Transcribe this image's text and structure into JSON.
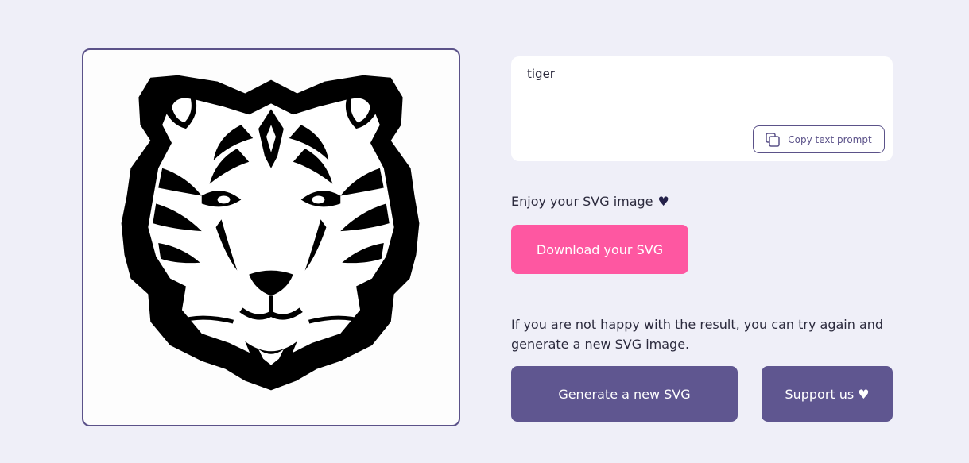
{
  "image_card": {
    "alt_subject": "tiger-illustration"
  },
  "prompt": {
    "text": "tiger",
    "copy_label": "Copy text prompt",
    "copy_icon": "copy-icon"
  },
  "result": {
    "enjoy_text": "Enjoy your SVG image",
    "enjoy_icon": "heart-icon",
    "download_label": "Download your SVG"
  },
  "retry": {
    "message": "If you are not happy with the result, you can try again and generate a new SVG image.",
    "generate_label": "Generate a new SVG",
    "support_label": "Support us",
    "support_icon": "heart-icon"
  },
  "colors": {
    "background": "#efeff8",
    "accent_pink": "#fe57a1",
    "accent_purple": "#5f5690",
    "border_purple": "#5b5289"
  }
}
